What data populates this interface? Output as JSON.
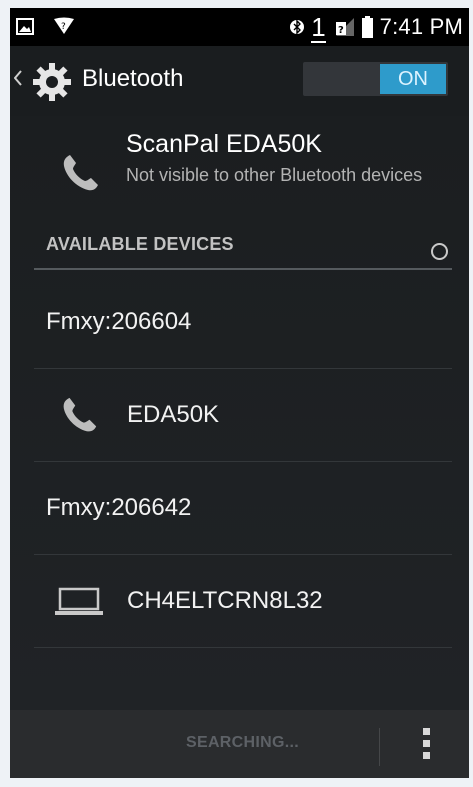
{
  "status_bar": {
    "sim_number": "1",
    "time": "7:41 PM"
  },
  "action_bar": {
    "title": "Bluetooth",
    "toggle_label": "ON"
  },
  "local_device": {
    "name": "ScanPal EDA50K",
    "visibility": "Not visible to other Bluetooth devices"
  },
  "available_devices": {
    "header": "AVAILABLE DEVICES",
    "items": [
      {
        "name": "Fmxy:206604",
        "icon": "none"
      },
      {
        "name": "EDA50K",
        "icon": "phone-icon"
      },
      {
        "name": "Fmxy:206642",
        "icon": "none"
      },
      {
        "name": "CH4ELTCRN8L32",
        "icon": "laptop-icon"
      }
    ]
  },
  "bottom_bar": {
    "action_label": "SEARCHING..."
  },
  "colors": {
    "accent": "#2e9bcb",
    "background": "#1b1e21",
    "status_bar": "#000000"
  }
}
